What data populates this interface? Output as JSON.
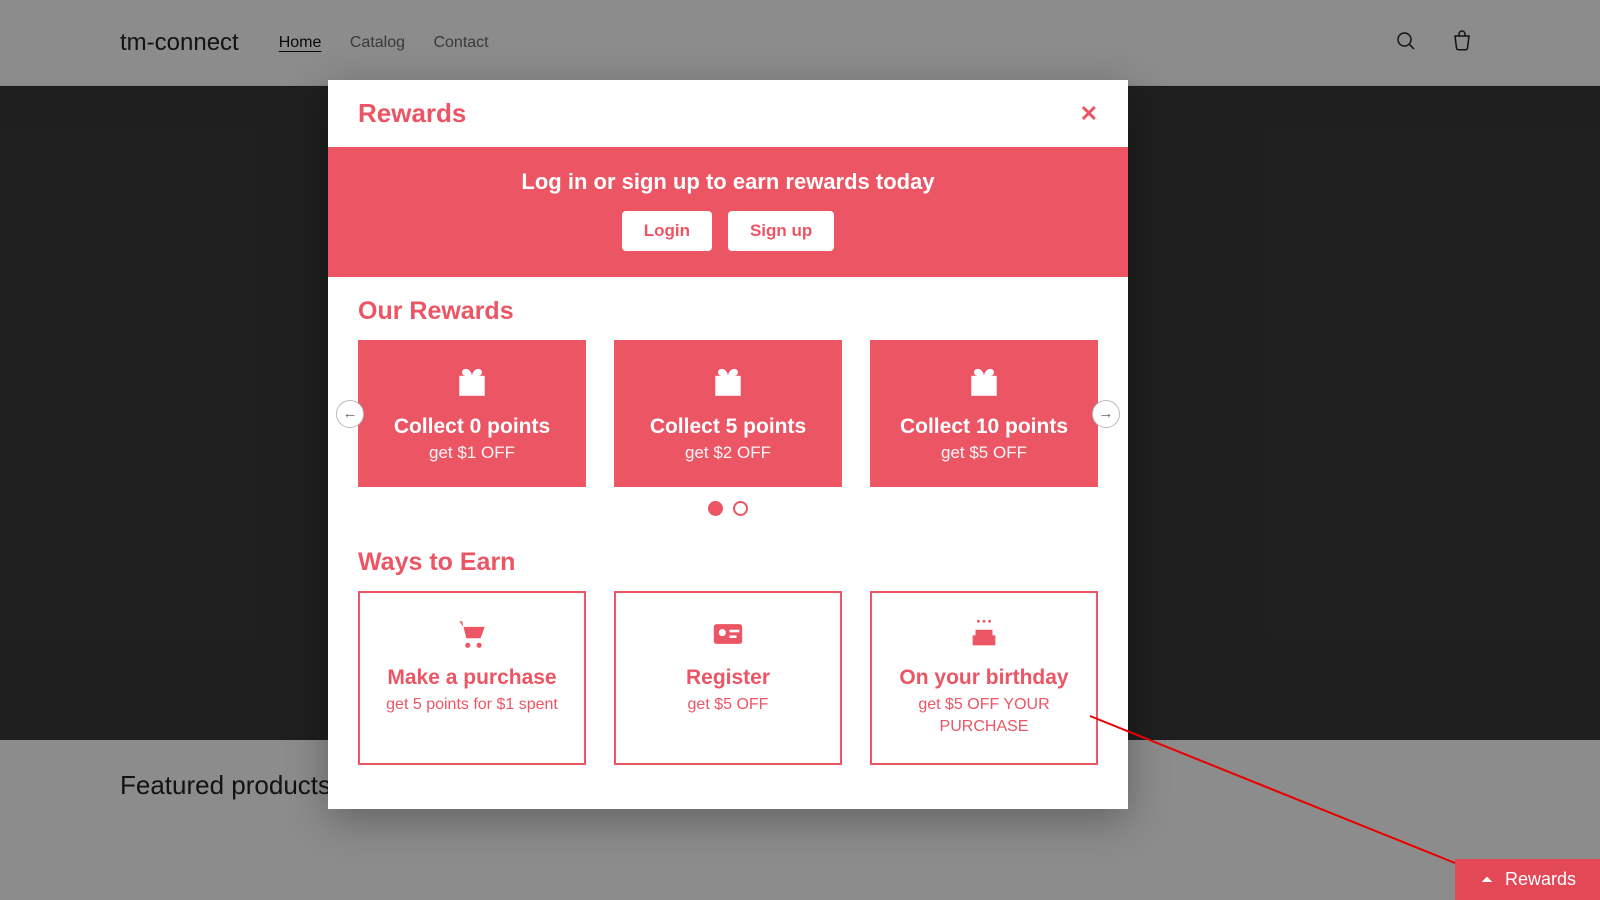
{
  "brand": "tm-connect",
  "nav": {
    "home": "Home",
    "catalog": "Catalog",
    "contact": "Contact"
  },
  "featured_title": "Featured products",
  "modal": {
    "title": "Rewards",
    "banner": {
      "text": "Log in or sign up to earn rewards today",
      "login": "Login",
      "signup": "Sign up"
    },
    "our_rewards_title": "Our Rewards",
    "rewards": [
      {
        "title": "Collect 0 points",
        "sub": "get $1 OFF"
      },
      {
        "title": "Collect 5 points",
        "sub": "get $2 OFF"
      },
      {
        "title": "Collect 10 points",
        "sub": "get $5 OFF"
      }
    ],
    "ways_title": "Ways to Earn",
    "earn": [
      {
        "title": "Make a purchase",
        "sub": "get 5 points for $1 spent"
      },
      {
        "title": "Register",
        "sub": "get $5 OFF"
      },
      {
        "title": "On your birthday",
        "sub": "get $5 OFF YOUR PURCHASE"
      }
    ]
  },
  "fab_label": "Rewards"
}
